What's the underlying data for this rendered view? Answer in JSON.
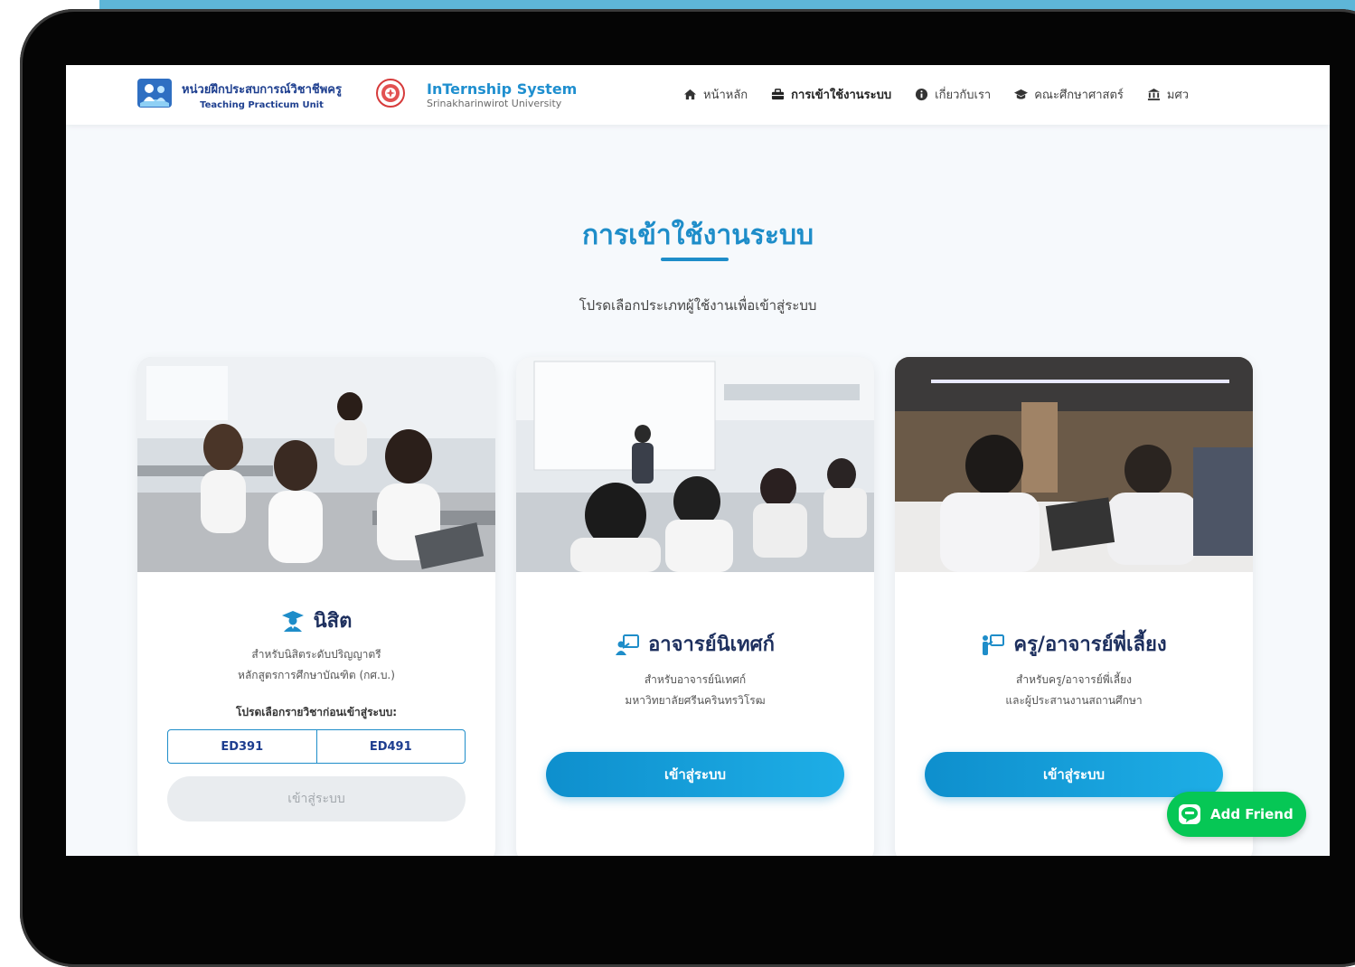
{
  "nav": {
    "unit_name_th": "หน่วยฝึกประสบการณ์วิชาชีพครู",
    "unit_name_en": "Teaching Practicum Unit",
    "system_title": "InTernship System",
    "system_subtitle": "Srinakharinwirot University",
    "menu": [
      {
        "label": "หน้าหลัก",
        "icon": "home-icon",
        "active": false
      },
      {
        "label": "การเข้าใช้งานระบบ",
        "icon": "briefcase-icon",
        "active": true
      },
      {
        "label": "เกี่ยวกับเรา",
        "icon": "info-icon",
        "active": false
      },
      {
        "label": "คณะศึกษาศาสตร์",
        "icon": "graduation-cap-icon",
        "active": false
      },
      {
        "label": "มศว",
        "icon": "university-icon",
        "active": false
      }
    ]
  },
  "main": {
    "heading": "การเข้าใช้งานระบบ",
    "subtitle": "โปรดเลือกประเภทผู้ใช้งานเพื่อเข้าสู่ระบบ"
  },
  "cards": [
    {
      "title": "นิสิต",
      "icon": "graduate-student-icon",
      "desc_line1": "สำหรับนิสิตระดับปริญญาตรี",
      "desc_line2": "หลักสูตรการศึกษาบัณฑิต (กศ.บ.)",
      "select_label": "โปรดเลือกรายวิชาก่อนเข้าสู่ระบบ:",
      "courses": [
        "ED391",
        "ED491"
      ],
      "button": "เข้าสู่ระบบ",
      "button_enabled": false
    },
    {
      "title": "อาจารย์นิเทศก์",
      "icon": "teacher-board-icon",
      "desc_line1": "สำหรับอาจารย์นิเทศก์",
      "desc_line2": "มหาวิทยาลัยศรีนครินทรวิโรฒ",
      "button": "เข้าสู่ระบบ",
      "button_enabled": true
    },
    {
      "title": "ครู/อาจารย์พี่เลี้ยง",
      "icon": "mentor-teacher-icon",
      "desc_line1": "สำหรับครู/อาจารย์พี่เลี้ยง",
      "desc_line2": "และผู้ประสานงานสถานศึกษา",
      "button": "เข้าสู่ระบบ",
      "button_enabled": true
    }
  ],
  "line_button": {
    "label": "Add Friend",
    "icon": "line-chat-icon",
    "color": "#06c755"
  },
  "colors": {
    "accent": "#1e8dc9",
    "title": "#1d2f5e",
    "device": "#050505",
    "top_band": "#5eb6d8"
  }
}
